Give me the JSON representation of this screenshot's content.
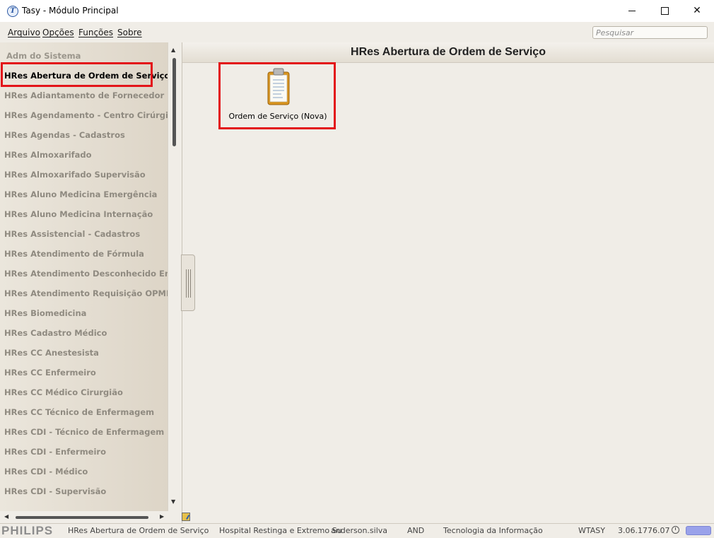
{
  "window": {
    "title": "Tasy - Módulo Principal",
    "app_icon_letter": "T"
  },
  "menu": {
    "items": [
      "Arquivo",
      "Opções",
      "Funções",
      "Sobre"
    ],
    "search_placeholder": "Pesquisar"
  },
  "sidebar": {
    "header": "Adm do Sistema",
    "selected": "HRes Abertura de Ordem de Serviço",
    "items": [
      "HRes Abertura de Ordem de Serviço",
      "HRes Adiantamento de Fornecedor",
      "HRes Agendamento - Centro Cirúrgico",
      "HRes Agendas - Cadastros",
      "HRes Almoxarifado",
      "HRes Almoxarifado Supervisão",
      "HRes Aluno Medicina Emergência",
      "HRes Aluno Medicina Internação",
      "HRes Assistencial - Cadastros",
      "HRes Atendimento de Fórmula",
      "HRes Atendimento Desconhecido Emerg.",
      "HRes Atendimento Requisição OPME",
      "HRes Biomedicina",
      "HRes Cadastro Médico",
      "HRes CC Anestesista",
      "HRes CC Enfermeiro",
      "HRes CC Médico Cirurgião",
      "HRes CC Técnico de Enfermagem",
      "HRes CDI -  Técnico de Enfermagem",
      "HRes CDI - Enfermeiro",
      "HRes CDI - Médico",
      "HRes CDI - Supervisão"
    ]
  },
  "main": {
    "title": "HRes Abertura de Ordem de Serviço",
    "tiles": [
      {
        "label": "Ordem de Serviço (Nova)",
        "icon": "clipboard-icon"
      }
    ]
  },
  "status": {
    "brand": "PHILIPS",
    "function": "HRes Abertura de Ordem de Serviço",
    "establishment": "Hospital Restinga e Extremo Su",
    "user": "anderson.silva",
    "floor": "AND",
    "sector": "Tecnologia da Informação",
    "database": "WTASY",
    "version": "3.06.1776.07"
  },
  "colors": {
    "highlight": "#e3151a",
    "status_indicator": "#9aa2ea"
  }
}
